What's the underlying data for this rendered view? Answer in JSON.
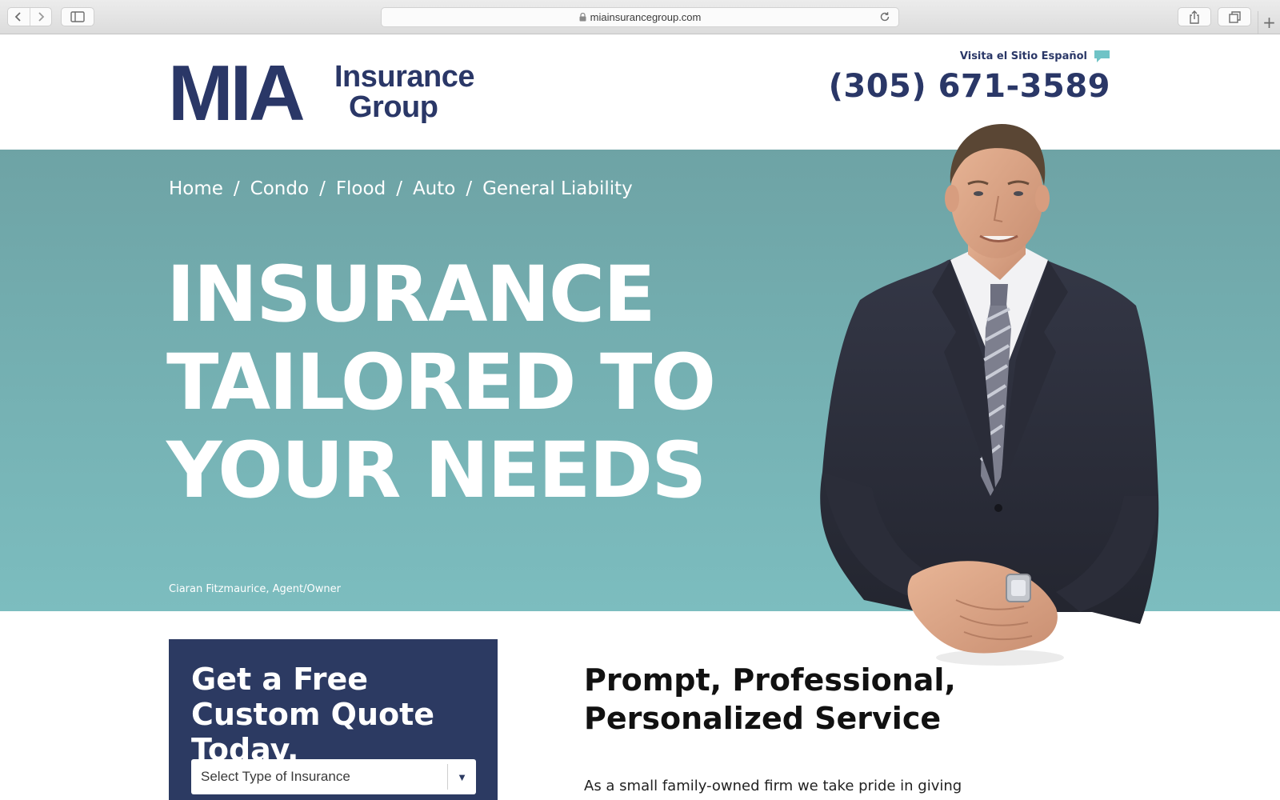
{
  "browser": {
    "url": "miainsurancegroup.com",
    "icons": {
      "back": "chevron-left-icon",
      "forward": "chevron-right-icon",
      "sidebar": "sidebar-icon",
      "lock": "lock-icon",
      "reload": "reload-icon",
      "share": "share-icon",
      "tabs": "tabs-icon",
      "new_tab": "plus-icon"
    },
    "new_tab_label": "+"
  },
  "header": {
    "logo": {
      "mark": "MIA",
      "line1": "Insurance",
      "line2": "Group"
    },
    "spanish_link": "Visita el Sitio Español",
    "phone": "(305) 671-3589"
  },
  "hero": {
    "breadcrumb": [
      "Home",
      "Condo",
      "Flood",
      "Auto",
      "General Liability"
    ],
    "breadcrumb_separator": "/",
    "heading_lines": [
      "INSURANCE",
      "TAILORED TO",
      "YOUR NEEDS"
    ],
    "caption": "Ciaran Fitzmaurice, Agent/Owner"
  },
  "quote": {
    "title": "Get a Free Custom Quote Today.",
    "select": {
      "value": "Select Type of Insurance",
      "arrow": "▼"
    }
  },
  "service": {
    "title": "Prompt, Professional, Personalized Service",
    "body": "As a small family-owned firm we take pride in giving"
  },
  "colors": {
    "brand_navy": "#2a3767",
    "hero_teal": "#74afb1",
    "quote_card": "#2c3a62",
    "chat_icon": "#6fc3c6"
  }
}
